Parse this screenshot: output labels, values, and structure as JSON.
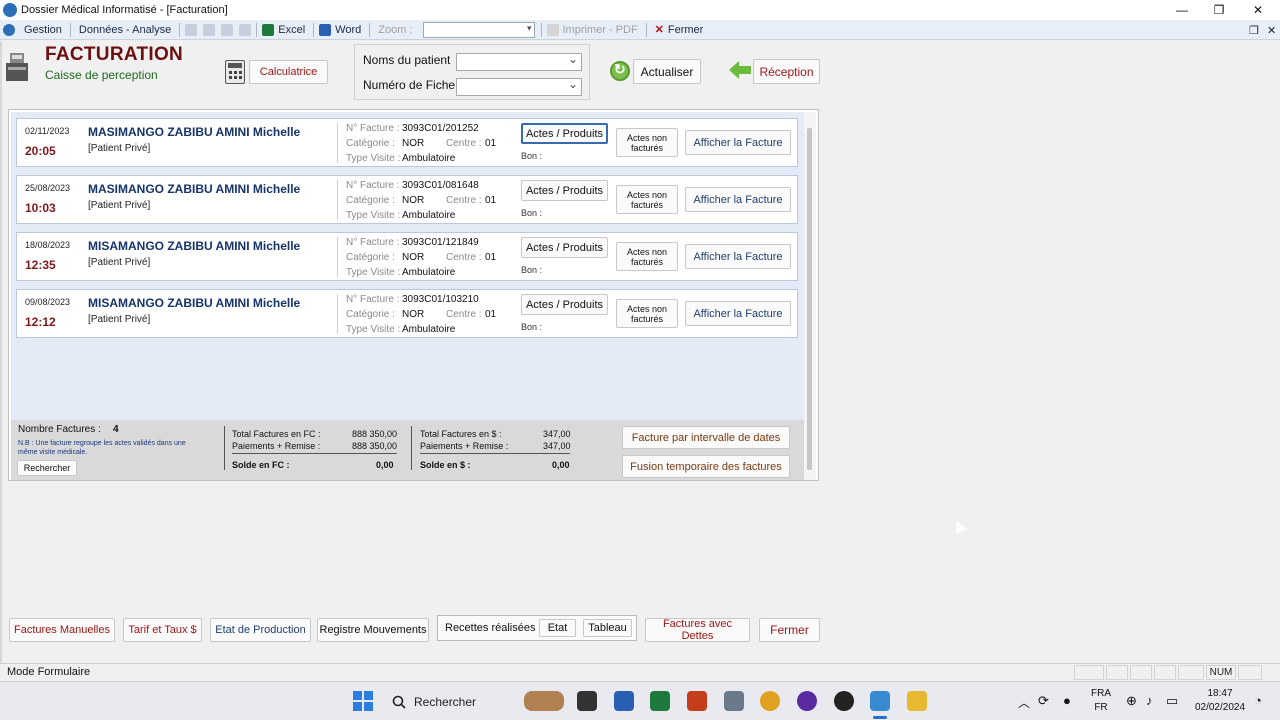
{
  "window": {
    "title": "Dossier Médical Informatisé - [Facturation]",
    "minimize": "—",
    "maximize": "❐",
    "close": "✕"
  },
  "menubar": {
    "gestion": "Gestion",
    "donnees": "Données - Analyse",
    "excel": "Excel",
    "word": "Word",
    "zoom_label": "Zoom :",
    "imprimer": "Imprimer - PDF",
    "fermer": "Fermer"
  },
  "header": {
    "title": "FACTURATION",
    "subtitle": "Caisse de perception",
    "calculatrice": "Calculatrice",
    "noms_patient_label": "Noms du patient",
    "numero_fiche_label": "Numéro de Fiche",
    "actualiser": "Actualiser",
    "reception": "Réception"
  },
  "labels": {
    "n_facture": "N° Facture :",
    "categorie": "Catégorie :",
    "centre": "Centre :",
    "type_visite": "Type Visite :",
    "bon": "Bon :",
    "actes_produits": "Actes / Produits",
    "actes_non_factures": "Actes non facturés",
    "afficher_facture": "Afficher la Facture"
  },
  "invoices": [
    {
      "date": "02/11/2023",
      "time": "20:05",
      "name": "MASIMANGO ZABIBU AMINI Michelle",
      "patient_type": "[Patient Privé]",
      "facture": "3093C01/201252",
      "categorie": "NOR",
      "centre": "01",
      "type_visite": "Ambulatoire"
    },
    {
      "date": "25/08/2023",
      "time": "10:03",
      "name": "MASIMANGO ZABIBU AMINI Michelle",
      "patient_type": "[Patient Privé]",
      "facture": "3093C01/081648",
      "categorie": "NOR",
      "centre": "01",
      "type_visite": "Ambulatoire"
    },
    {
      "date": "18/08/2023",
      "time": "12:35",
      "name": "MISAMANGO ZABIBU AMINI Michelle",
      "patient_type": "[Patient Privé]",
      "facture": "3093C01/121849",
      "categorie": "NOR",
      "centre": "01",
      "type_visite": "Ambulatoire"
    },
    {
      "date": "09/08/2023",
      "time": "12:12",
      "name": "MISAMANGO ZABIBU AMINI Michelle",
      "patient_type": "[Patient Privé]",
      "facture": "3093C01/103210",
      "categorie": "NOR",
      "centre": "01",
      "type_visite": "Ambulatoire"
    }
  ],
  "summary": {
    "nombre_label": "Nombre Factures :",
    "nombre_value": "4",
    "nb_note": "N.B : Une facture regroupe les actes validés dans une même visite médicale.",
    "rechercher": "Rechercher",
    "total_fc_label": "Total Factures en FC :",
    "total_fc_value": "888 350,00",
    "paiements_fc_label": "Paiements + Remise :",
    "paiements_fc_value": "888 350,00",
    "solde_fc_label": "Solde en FC :",
    "solde_fc_value": "0,00",
    "total_usd_label": "Total Factures en $ :",
    "total_usd_value": "347,00",
    "paiements_usd_label": "Paiements + Remise :",
    "paiements_usd_value": "347,00",
    "solde_usd_label": "Solde en $ :",
    "solde_usd_value": "0,00",
    "facture_intervalle": "Facture par intervalle de dates",
    "fusion": "Fusion temporaire des factures"
  },
  "bottom": {
    "factures_manuelles": "Factures Manuelles",
    "tarif": "Tarif et Taux $",
    "etat_production": "Etat de Production",
    "registre": "Registre Mouvements",
    "recettes": "Recettes réalisées :",
    "etat": "Etat",
    "tableau": "Tableau",
    "factures_dettes": "Factures avec Dettes",
    "fermer": "Fermer"
  },
  "status": {
    "mode": "Mode Formulaire",
    "num": "NUM"
  },
  "taskbar": {
    "search": "Rechercher",
    "lang1": "FRA",
    "lang2": "FR",
    "time": "18:47",
    "date": "02/02/2024"
  },
  "colors": {
    "accent_red": "#a01818",
    "accent_blue": "#16336a",
    "list_bg": "#e4ebf7"
  }
}
